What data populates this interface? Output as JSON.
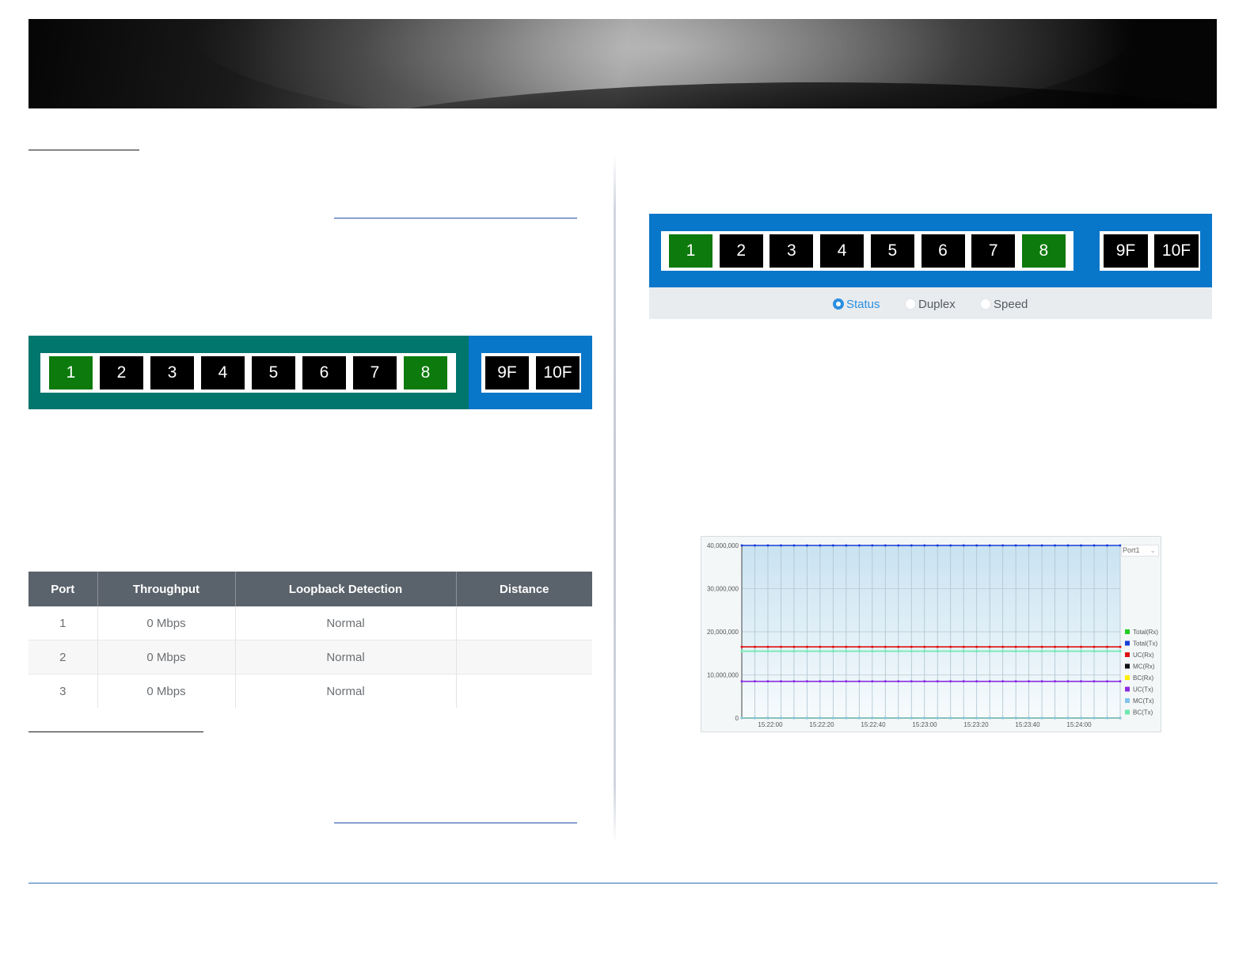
{
  "page": {
    "left_ports": {
      "group_a": [
        {
          "label": "1",
          "active": true
        },
        {
          "label": "2",
          "active": false
        },
        {
          "label": "3",
          "active": false
        },
        {
          "label": "4",
          "active": false
        },
        {
          "label": "5",
          "active": false
        },
        {
          "label": "6",
          "active": false
        },
        {
          "label": "7",
          "active": false
        },
        {
          "label": "8",
          "active": true
        }
      ],
      "group_b": [
        {
          "label": "9F",
          "active": false
        },
        {
          "label": "10F",
          "active": false
        }
      ]
    },
    "right_ports": {
      "group_a": [
        {
          "label": "1",
          "active": true
        },
        {
          "label": "2",
          "active": false
        },
        {
          "label": "3",
          "active": false
        },
        {
          "label": "4",
          "active": false
        },
        {
          "label": "5",
          "active": false
        },
        {
          "label": "6",
          "active": false
        },
        {
          "label": "7",
          "active": false
        },
        {
          "label": "8",
          "active": true
        }
      ],
      "group_b": [
        {
          "label": "9F",
          "active": false
        },
        {
          "label": "10F",
          "active": false
        }
      ],
      "view_options": [
        {
          "label": "Status",
          "selected": true
        },
        {
          "label": "Duplex",
          "selected": false
        },
        {
          "label": "Speed",
          "selected": false
        }
      ]
    },
    "table": {
      "headers": [
        "Port",
        "Throughput",
        "Loopback Detection",
        "Distance"
      ],
      "rows": [
        [
          "1",
          "0 Mbps",
          "Normal",
          ""
        ],
        [
          "2",
          "0 Mbps",
          "Normal",
          ""
        ],
        [
          "3",
          "0 Mbps",
          "Normal",
          ""
        ]
      ]
    },
    "colors": {
      "active_port": "#0c7a0c",
      "inactive_port": "#000000",
      "teal": "#00766c",
      "blue": "#0876c9",
      "header_gray": "#5a626b"
    }
  },
  "chart_data": {
    "type": "line",
    "ylim": [
      0,
      40000000
    ],
    "y_ticks": [
      "0",
      "10,000,000",
      "20,000,000",
      "30,000,000",
      "40,000,000"
    ],
    "x_ticks": [
      "15:22:00",
      "15:22:20",
      "15:22:40",
      "15:23:00",
      "15:23:20",
      "15:23:40",
      "15:24:00"
    ],
    "port_select": "Port1",
    "legend_position": "right",
    "grid": true,
    "series": [
      {
        "name": "Total(Rx)",
        "color": "#22cc22",
        "value": 0
      },
      {
        "name": "Total(Tx)",
        "color": "#1a3fd6",
        "value": 40000000
      },
      {
        "name": "UC(Rx)",
        "color": "#e01010",
        "value": 16500000
      },
      {
        "name": "MC(Rx)",
        "color": "#111111",
        "value": 0
      },
      {
        "name": "BC(Rx)",
        "color": "#ffee00",
        "value": 0
      },
      {
        "name": "UC(Tx)",
        "color": "#8a2be2",
        "value": 8500000
      },
      {
        "name": "MC(Tx)",
        "color": "#7fc4ee",
        "value": 0
      },
      {
        "name": "BC(Tx)",
        "color": "#6ee8b0",
        "value": 15500000
      }
    ],
    "points_per_series": 30
  }
}
